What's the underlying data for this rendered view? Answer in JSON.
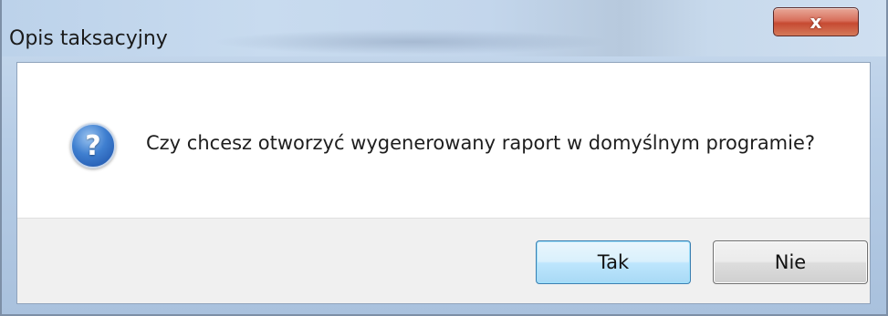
{
  "window": {
    "title": "Opis taksacyjny",
    "close_icon": "close-icon",
    "close_glyph": "x"
  },
  "dialog": {
    "icon": "question-icon",
    "icon_glyph": "?",
    "message": "Czy chcesz otworzyć wygenerowany raport w domyślnym programie?"
  },
  "buttons": {
    "yes_label": "Tak",
    "no_label": "Nie"
  },
  "colors": {
    "close_button": "#c64a32",
    "default_button_border": "#3c7fb1",
    "icon_blue": "#1c4fa6"
  }
}
